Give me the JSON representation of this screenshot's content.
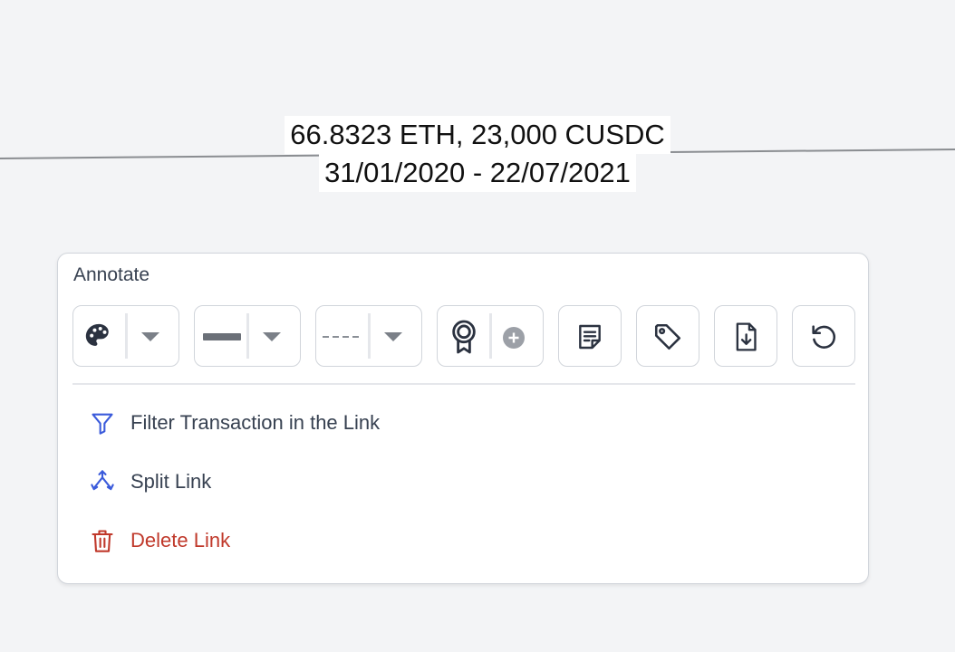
{
  "link_label": {
    "amounts": "66.8323 ETH, 23,000 CUSDC",
    "dates": "31/01/2020 - 22/07/2021"
  },
  "panel": {
    "title": "Annotate",
    "toolbar": [
      {
        "name": "color-picker",
        "icon": "palette-icon",
        "has_dropdown": true
      },
      {
        "name": "line-weight",
        "icon": "line-weight-icon",
        "has_dropdown": true
      },
      {
        "name": "line-style",
        "icon": "dashed-line-icon",
        "has_dropdown": true
      },
      {
        "name": "badge",
        "icon": "award-icon",
        "secondary_icon": "plus-circle-icon"
      },
      {
        "name": "note",
        "icon": "note-icon"
      },
      {
        "name": "tag",
        "icon": "tag-icon"
      },
      {
        "name": "export",
        "icon": "file-download-icon"
      },
      {
        "name": "reset",
        "icon": "undo-icon"
      }
    ],
    "menu": {
      "filter_label": "Filter Transaction in the Link",
      "split_label": "Split Link",
      "delete_label": "Delete Link"
    }
  },
  "colors": {
    "accent": "#3b5bdb",
    "danger": "#c0392b",
    "text": "#374151",
    "border": "#d1d5db"
  }
}
